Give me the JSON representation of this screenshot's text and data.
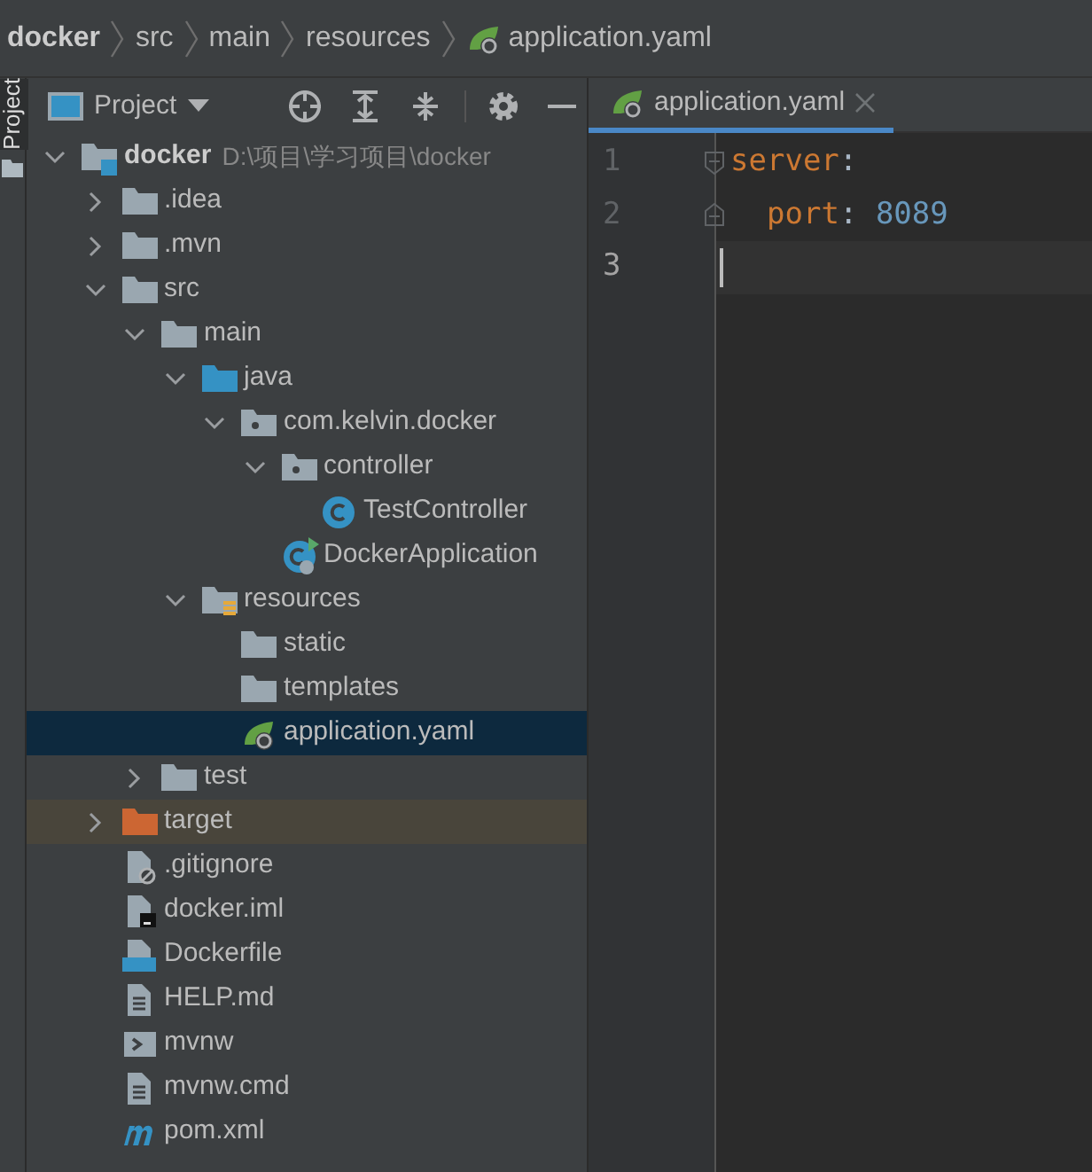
{
  "breadcrumbs": [
    {
      "label": "docker",
      "kind": "root"
    },
    {
      "label": "src",
      "kind": "folder"
    },
    {
      "label": "main",
      "kind": "folder"
    },
    {
      "label": "resources",
      "kind": "folder"
    },
    {
      "label": "application.yaml",
      "kind": "yaml"
    }
  ],
  "side_tab": {
    "label": "Project",
    "selected": true
  },
  "project_panel": {
    "title": "Project"
  },
  "tree": [
    {
      "label": "docker",
      "path": "D:\\项目\\学习项目\\docker",
      "kind": "module",
      "expanded": true,
      "selected": false,
      "children": [
        {
          "label": ".idea",
          "kind": "folder",
          "expanded": false,
          "selected": false
        },
        {
          "label": ".mvn",
          "kind": "folder",
          "expanded": false,
          "selected": false
        },
        {
          "label": "src",
          "kind": "folder",
          "expanded": true,
          "selected": false,
          "children": [
            {
              "label": "main",
              "kind": "folder",
              "expanded": true,
              "selected": false,
              "children": [
                {
                  "label": "java",
                  "kind": "source-folder",
                  "expanded": true,
                  "selected": false,
                  "children": [
                    {
                      "label": "com.kelvin.docker",
                      "kind": "package",
                      "expanded": true,
                      "selected": false,
                      "children": [
                        {
                          "label": "controller",
                          "kind": "package",
                          "expanded": true,
                          "selected": false,
                          "children": [
                            {
                              "label": "TestController",
                              "kind": "class",
                              "selected": false
                            }
                          ]
                        },
                        {
                          "label": "DockerApplication",
                          "kind": "spring-class",
                          "selected": false
                        }
                      ]
                    }
                  ]
                },
                {
                  "label": "resources",
                  "kind": "resources-folder",
                  "expanded": true,
                  "selected": false,
                  "children": [
                    {
                      "label": "static",
                      "kind": "folder",
                      "selected": false
                    },
                    {
                      "label": "templates",
                      "kind": "folder",
                      "selected": false
                    },
                    {
                      "label": "application.yaml",
                      "kind": "yaml",
                      "selected": true
                    }
                  ]
                }
              ]
            },
            {
              "label": "test",
              "kind": "folder",
              "expanded": false,
              "selected": false
            }
          ]
        },
        {
          "label": "target",
          "kind": "excluded-folder",
          "expanded": false,
          "selected": false
        },
        {
          "label": ".gitignore",
          "kind": "gitignore",
          "selected": false
        },
        {
          "label": "docker.iml",
          "kind": "iml",
          "selected": false
        },
        {
          "label": "Dockerfile",
          "kind": "dockerfile",
          "selected": false
        },
        {
          "label": "HELP.md",
          "kind": "text",
          "selected": false
        },
        {
          "label": "mvnw",
          "kind": "script",
          "selected": false
        },
        {
          "label": "mvnw.cmd",
          "kind": "text",
          "selected": false
        },
        {
          "label": "pom.xml",
          "kind": "maven",
          "selected": false
        }
      ]
    }
  ],
  "editor_tabs": [
    {
      "label": "application.yaml",
      "kind": "yaml",
      "selected": true
    }
  ],
  "code_lines": [
    {
      "number": "1",
      "foldable": true,
      "current": false,
      "tokens": [
        {
          "text": "server",
          "kind": "key"
        },
        {
          "text": ":",
          "kind": "punct"
        }
      ],
      "children": [
        {
          "number": "2",
          "foldable": true,
          "current": false,
          "tokens": [
            {
              "text": "port",
              "kind": "key"
            },
            {
              "text": ": ",
              "kind": "punct"
            },
            {
              "text": "8089",
              "kind": "number"
            }
          ]
        }
      ]
    },
    {
      "number": "3",
      "foldable": false,
      "current": true
    }
  ]
}
